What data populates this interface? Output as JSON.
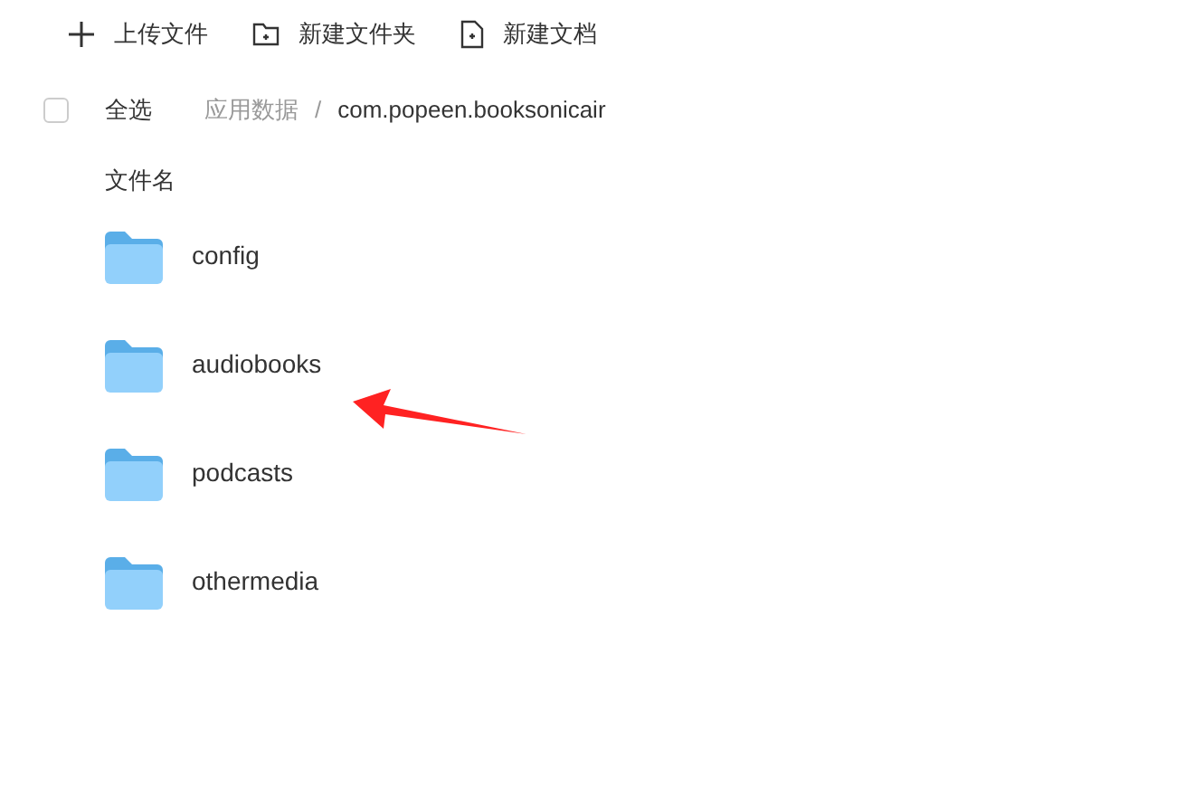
{
  "toolbar": [
    {
      "kind": "upload",
      "label": "上传文件"
    },
    {
      "kind": "folder",
      "label": "新建文件夹"
    },
    {
      "kind": "document",
      "label": "新建文档"
    }
  ],
  "select_all": {
    "label": "全选",
    "checked": false
  },
  "breadcrumb": [
    {
      "label": "应用数据",
      "current": false
    },
    {
      "label": "/",
      "current": false
    },
    {
      "label": "com.popeen.booksonicair",
      "current": true
    }
  ],
  "column_header": "文件名",
  "files": [
    {
      "name": "config"
    },
    {
      "name": "audiobooks"
    },
    {
      "name": "podcasts"
    },
    {
      "name": "othermedia"
    }
  ]
}
